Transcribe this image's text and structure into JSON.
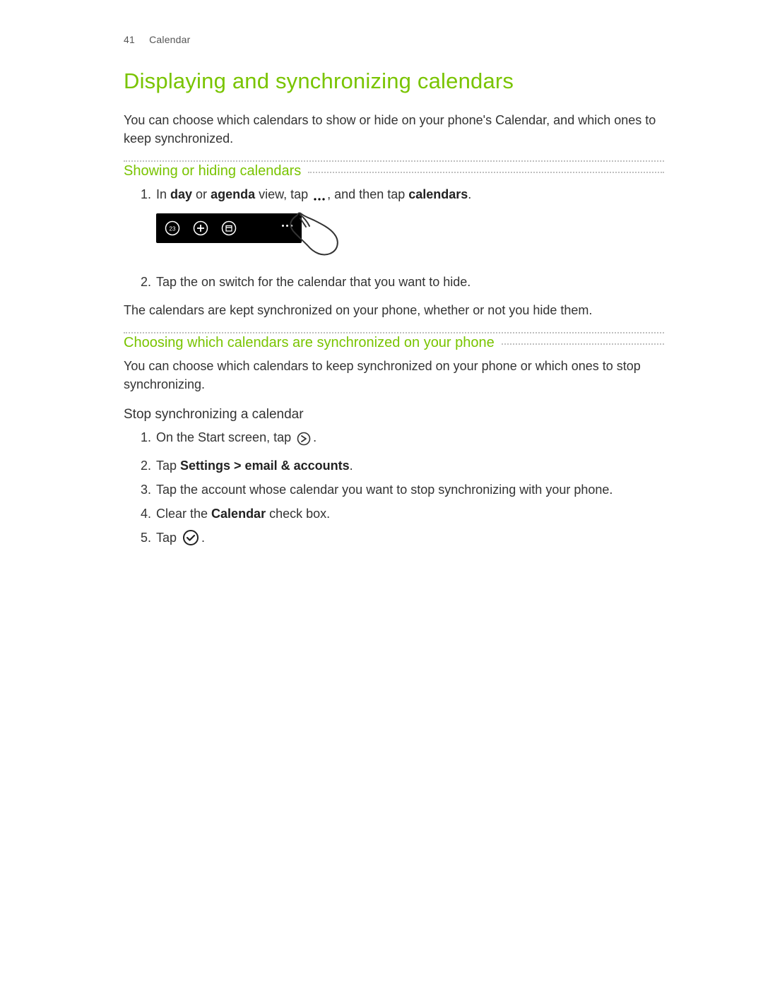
{
  "colors": {
    "accent": "#79c400"
  },
  "header": {
    "page_number": "41",
    "section": "Calendar"
  },
  "title": "Displaying and synchronizing calendars",
  "intro": "You can choose which calendars to show or hide on your phone's Calendar, and which ones to keep synchronized.",
  "sec1": {
    "heading": "Showing or hiding calendars",
    "step1": {
      "pre": "In ",
      "b1": "day",
      "mid1": " or ",
      "b2": "agenda",
      "mid2": " view, tap ",
      "icon": "more-options-icon",
      "mid3": ", and then tap ",
      "b3": "calendars",
      "end": "."
    },
    "illustration": {
      "icons": [
        "calendar-date-icon",
        "add-icon",
        "today-icon",
        "more-options-icon"
      ],
      "action": "finger-tap"
    },
    "step2": "Tap the on switch for the calendar that you want to hide.",
    "after": "The calendars are kept synchronized on your phone, whether or not you hide them."
  },
  "sec2": {
    "heading": "Choosing which calendars are synchronized on your phone",
    "intro": "You can choose which calendars to keep synchronized on your phone or which ones to stop synchronizing.",
    "sub_heading": "Stop synchronizing a calendar",
    "steps": {
      "s1": {
        "pre": "On the Start screen, tap ",
        "icon": "arrow-right-icon",
        "end": "."
      },
      "s2": {
        "pre": "Tap ",
        "b1": "Settings > email & accounts",
        "end": "."
      },
      "s3": "Tap the account whose calendar you want to stop synchronizing with your phone.",
      "s4": {
        "pre": "Clear the ",
        "b1": "Calendar",
        "end": " check box."
      },
      "s5": {
        "pre": "Tap ",
        "icon": "check-circle-icon",
        "end": "."
      }
    }
  }
}
